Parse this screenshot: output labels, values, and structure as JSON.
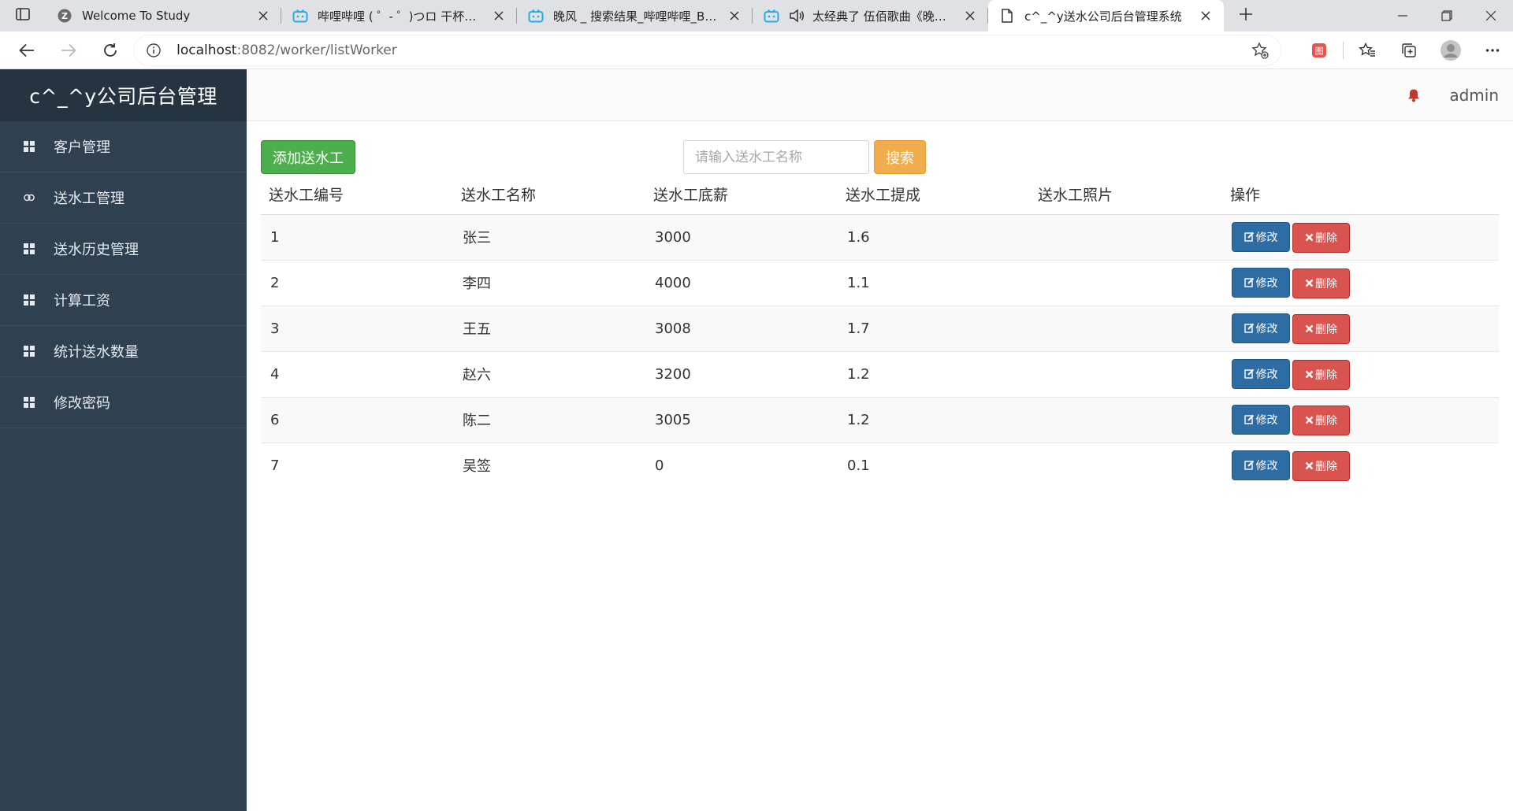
{
  "browser": {
    "tabs": [
      {
        "title": "Welcome To Study",
        "icon": "zotero-icon",
        "active": false
      },
      {
        "title": "哔哩哔哩 ( ゜- ゜)つロ 干杯~-bilibili",
        "icon": "bilibili-icon",
        "active": false
      },
      {
        "title": "晚风 _ 搜索结果_哔哩哔哩_Bilibili",
        "icon": "bilibili-icon",
        "active": false
      },
      {
        "title": "太经典了 伍佰歌曲《晚风》",
        "icon": "bilibili-icon",
        "active": false,
        "audio": true
      },
      {
        "title": "c^_^y送水公司后台管理系统",
        "icon": "page-icon",
        "active": true
      }
    ],
    "url_host": "localhost",
    "url_rest": ":8082/worker/listWorker"
  },
  "app": {
    "brand": "c^_^y公司后台管理",
    "menu": [
      {
        "label": "客户管理",
        "icon": "grid-icon"
      },
      {
        "label": "送水工管理",
        "icon": "link-icon"
      },
      {
        "label": "送水历史管理",
        "icon": "grid-icon"
      },
      {
        "label": "计算工资",
        "icon": "grid-icon"
      },
      {
        "label": "统计送水数量",
        "icon": "grid-icon"
      },
      {
        "label": "修改密码",
        "icon": "grid-icon"
      }
    ],
    "user": "admin"
  },
  "content": {
    "add_label": "添加送水工",
    "search_placeholder": "请输入送水工名称",
    "search_label": "搜索",
    "columns": [
      "送水工编号",
      "送水工名称",
      "送水工底薪",
      "送水工提成",
      "送水工照片",
      "操作"
    ],
    "rows": [
      {
        "id": "1",
        "name": "张三",
        "salary": "3000",
        "commission": "1.6",
        "photo": ""
      },
      {
        "id": "2",
        "name": "李四",
        "salary": "4000",
        "commission": "1.1",
        "photo": ""
      },
      {
        "id": "3",
        "name": "王五",
        "salary": "3008",
        "commission": "1.7",
        "photo": ""
      },
      {
        "id": "4",
        "name": "赵六",
        "salary": "3200",
        "commission": "1.2",
        "photo": ""
      },
      {
        "id": "6",
        "name": "陈二",
        "salary": "3005",
        "commission": "1.2",
        "photo": ""
      },
      {
        "id": "7",
        "name": "吴签",
        "salary": "0",
        "commission": "0.1",
        "photo": ""
      }
    ],
    "edit_label": "修改",
    "delete_label": "删除"
  },
  "colors": {
    "sidebar": "#2f4050",
    "brand_bg": "#263340",
    "add_button": "#4cae4c",
    "search_button": "#f0ad4e",
    "edit_button": "#2e6da4",
    "delete_button": "#d9534f"
  }
}
